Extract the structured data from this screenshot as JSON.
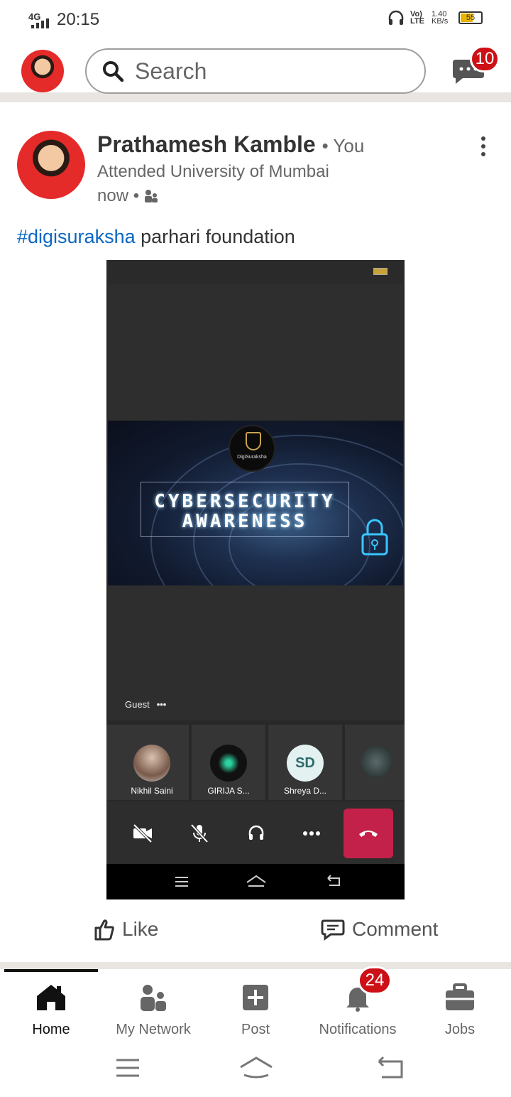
{
  "status_bar": {
    "network": "4G",
    "time": "20:15",
    "volte": "Vo) LTE",
    "speed": "1.40 KB/s",
    "battery": "55"
  },
  "top_bar": {
    "search_placeholder": "Search",
    "messages_badge": "10"
  },
  "post": {
    "author": "Prathamesh Kamble",
    "author_suffix": "• You",
    "headline": "Attended University of Mumbai",
    "time": "now •",
    "hashtag": "#digisuraksha",
    "text": " parhari foundation",
    "media": {
      "logo_text": "DigiSuraksha",
      "banner_line1": "CYBERSECURITY",
      "banner_line2": "AWARENESS",
      "guest_label": "Guest",
      "participants": [
        {
          "name": "Nikhil Saini"
        },
        {
          "name": "GIRIJA S..."
        },
        {
          "name": "Shreya D...",
          "initials": "SD"
        }
      ]
    }
  },
  "actions": {
    "like": "Like",
    "comment": "Comment"
  },
  "bottom_nav": {
    "home": "Home",
    "network": "My Network",
    "post": "Post",
    "notifications": "Notifications",
    "notifications_badge": "24",
    "jobs": "Jobs"
  },
  "colors": {
    "brand_blue": "#0a66c2",
    "badge_red": "#cc1016",
    "end_call": "#c4214a"
  }
}
